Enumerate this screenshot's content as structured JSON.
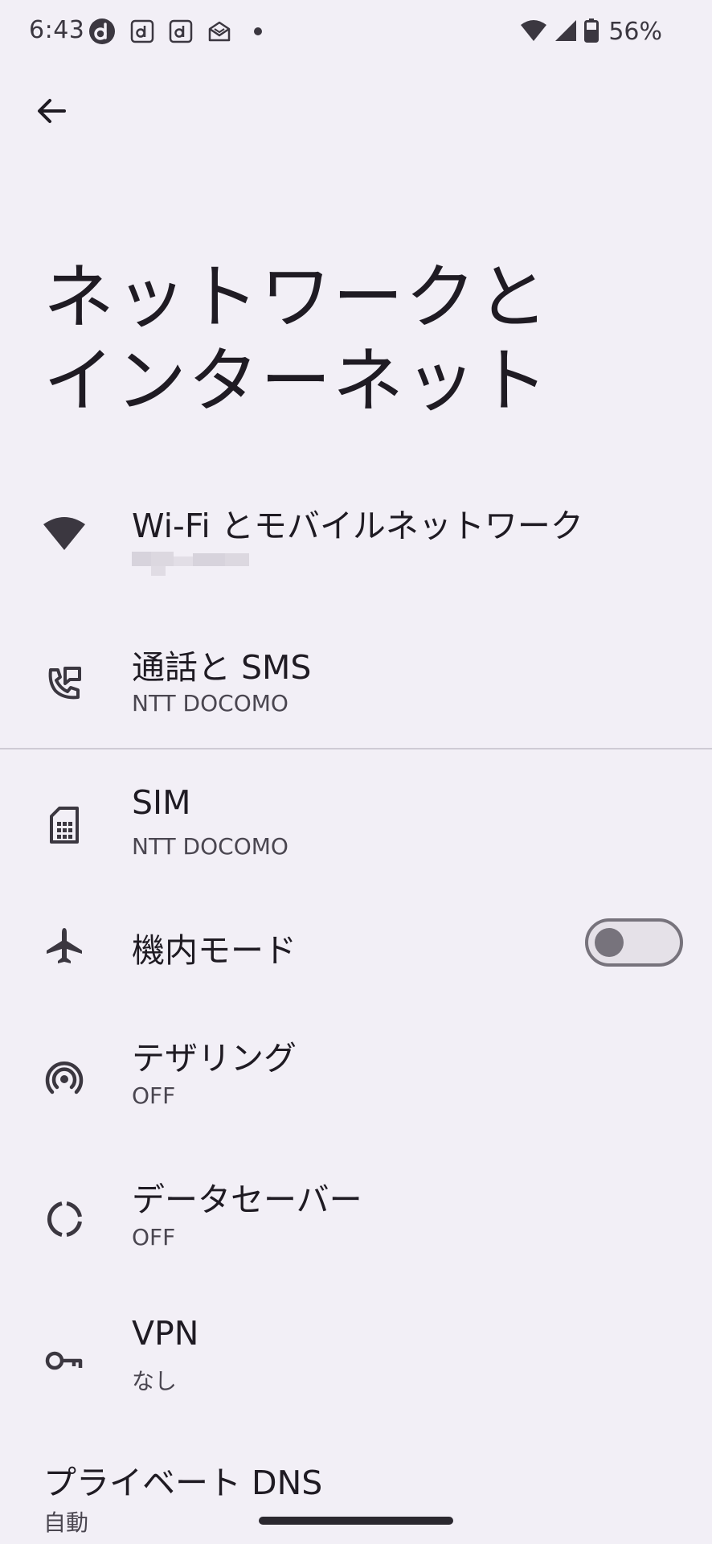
{
  "status_bar": {
    "time": "6:43",
    "battery_percent": "56%",
    "icons_left": [
      "docomo-d-icon",
      "d-app-icon",
      "d-app-icon",
      "mail-icon",
      "dot-icon"
    ],
    "icons_right": [
      "wifi-icon",
      "cell-signal-icon",
      "battery-icon"
    ]
  },
  "header": {
    "back_icon": "arrow-back-icon",
    "title": "ネットワークと\nインターネット"
  },
  "items": [
    {
      "icon": "wifi-icon",
      "title": "Wi-Fi とモバイルネットワーク",
      "subtitle": ""
    },
    {
      "icon": "phone-sms-icon",
      "title": "通話と SMS",
      "subtitle": "NTT DOCOMO"
    },
    {
      "icon": "sim-card-icon",
      "title": "SIM",
      "subtitle": "NTT DOCOMO"
    },
    {
      "icon": "airplane-icon",
      "title": "機内モード",
      "subtitle": "",
      "toggle_on": false
    },
    {
      "icon": "hotspot-icon",
      "title": "テザリング",
      "subtitle": "OFF"
    },
    {
      "icon": "data-saver-icon",
      "title": "データセーバー",
      "subtitle": "OFF"
    },
    {
      "icon": "vpn-key-icon",
      "title": "VPN",
      "subtitle": "なし"
    },
    {
      "icon": "",
      "title": "プライベート DNS",
      "subtitle": "自動"
    }
  ],
  "colors": {
    "background": "#f2eff6",
    "text_primary": "#1f1b23",
    "text_secondary": "#4a4650",
    "toggle_outline": "#77737c"
  }
}
